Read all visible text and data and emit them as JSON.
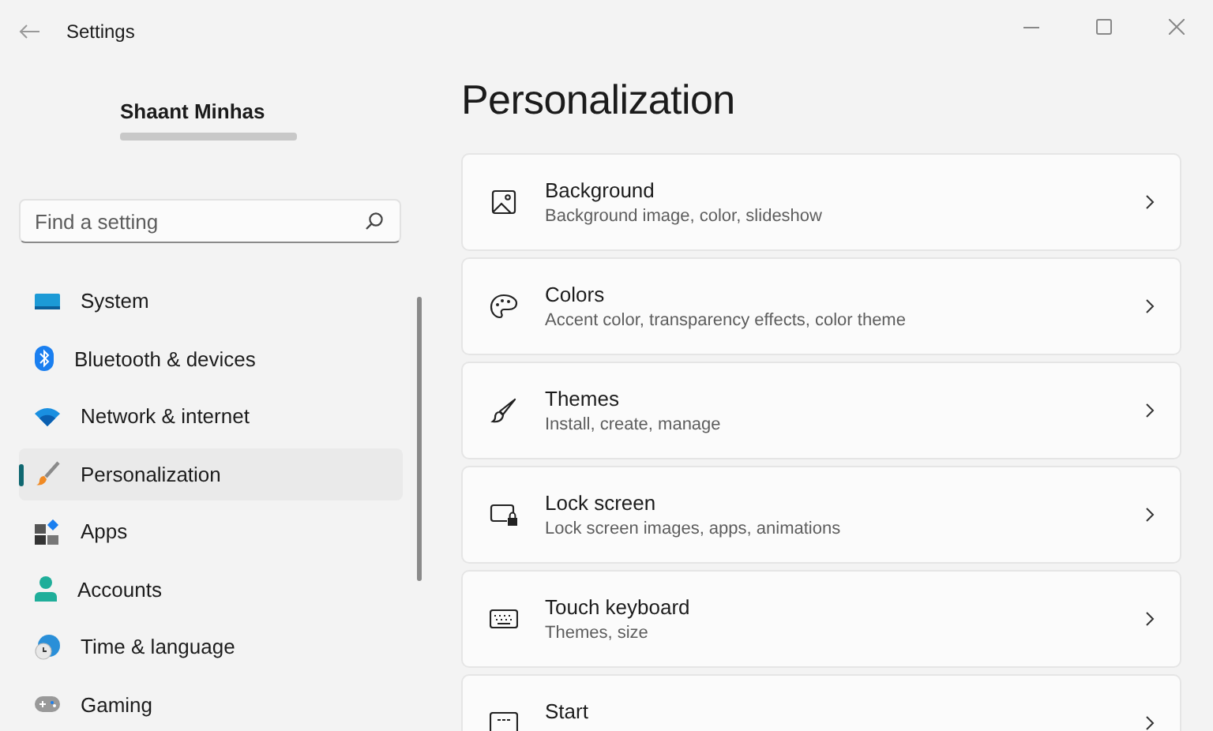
{
  "window": {
    "title": "Settings"
  },
  "account": {
    "name": "Shaant Minhas"
  },
  "search": {
    "placeholder": "Find a setting"
  },
  "sidebar": {
    "items": [
      {
        "label": "System",
        "kind": "system",
        "selected": false
      },
      {
        "label": "Bluetooth & devices",
        "kind": "bluetooth",
        "selected": false
      },
      {
        "label": "Network & internet",
        "kind": "network",
        "selected": false
      },
      {
        "label": "Personalization",
        "kind": "brush",
        "selected": true
      },
      {
        "label": "Apps",
        "kind": "apps",
        "selected": false
      },
      {
        "label": "Accounts",
        "kind": "person",
        "selected": false
      },
      {
        "label": "Time & language",
        "kind": "clock",
        "selected": false
      },
      {
        "label": "Gaming",
        "kind": "gamepad",
        "selected": false
      }
    ]
  },
  "page": {
    "title": "Personalization",
    "cards": [
      {
        "title": "Background",
        "subtitle": "Background image, color, slideshow",
        "kind": "image"
      },
      {
        "title": "Colors",
        "subtitle": "Accent color, transparency effects, color theme",
        "kind": "palette"
      },
      {
        "title": "Themes",
        "subtitle": "Install, create, manage",
        "kind": "brush"
      },
      {
        "title": "Lock screen",
        "subtitle": "Lock screen images, apps, animations",
        "kind": "lock"
      },
      {
        "title": "Touch keyboard",
        "subtitle": "Themes, size",
        "kind": "keyboard"
      },
      {
        "title": "Start",
        "kind": "start"
      }
    ]
  }
}
